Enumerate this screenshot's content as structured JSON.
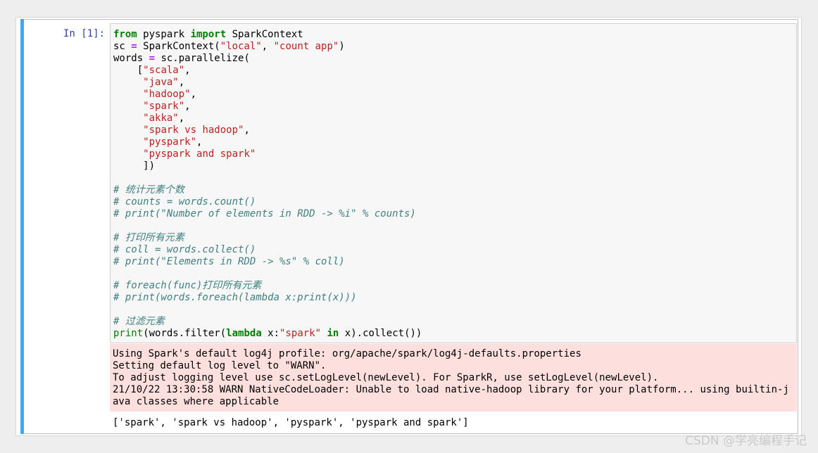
{
  "cell": {
    "prompt": "In [1]:",
    "code": {
      "l1": {
        "k1": "from",
        "t1": " pyspark ",
        "k2": "import",
        "t2": " SparkContext"
      },
      "l2": {
        "t1": "sc ",
        "op": "=",
        "t2": " SparkContext(",
        "s1": "\"local\"",
        "t3": ", ",
        "s2": "\"count app\"",
        "t4": ")"
      },
      "l3": {
        "t1": "words ",
        "op": "=",
        "t2": " sc.parallelize("
      },
      "list_open": "[",
      "items": [
        "\"scala\"",
        "\"java\"",
        "\"hadoop\"",
        "\"spark\"",
        "\"akka\"",
        "\"spark vs hadoop\"",
        "\"pyspark\"",
        "\"pyspark and spark\""
      ],
      "list_close": "])",
      "comments_count": [
        "# 统计元素个数",
        "# counts = words.count()",
        "# print(\"Number of elements in RDD -> %i\" % counts)"
      ],
      "comments_collect": [
        "# 打印所有元素",
        "# coll = words.collect()",
        "# print(\"Elements in RDD -> %s\" % coll)"
      ],
      "comments_foreach": [
        "# foreach(func)打印所有元素",
        "# print(words.foreach(lambda x:print(x)))"
      ],
      "comment_filter": "# 过滤元素",
      "last": {
        "b1": "print",
        "t1": "(words.filter(",
        "k1": "lambda",
        "t2": " x:",
        "s1": "\"spark\"",
        "t3": " ",
        "k2": "in",
        "t4": " x).collect())"
      }
    },
    "stderr": [
      "Using Spark's default log4j profile: org/apache/spark/log4j-defaults.properties",
      "Setting default log level to \"WARN\".",
      "To adjust logging level use sc.setLogLevel(newLevel). For SparkR, use setLogLevel(newLevel).",
      "21/10/22 13:30:58 WARN NativeCodeLoader: Unable to load native-hadoop library for your platform... using builtin-j",
      "ava classes where applicable"
    ],
    "stdout": "['spark', 'spark vs hadoop', 'pyspark', 'pyspark and spark']"
  },
  "watermark": "CSDN @学亮编程手记",
  "colors": {
    "selected_bar": "#42a5f5",
    "keyword": "#008000",
    "string": "#ba2121",
    "comment": "#408080",
    "operator": "#aa22ff",
    "stderr_bg": "#fddfdd",
    "prompt": "#303f9f"
  }
}
